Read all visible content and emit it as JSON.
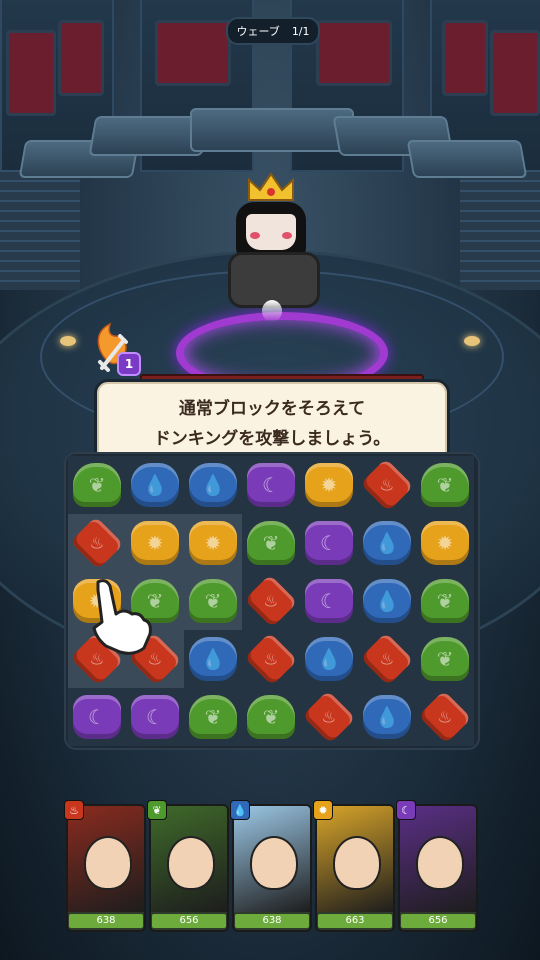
{
  "wave": {
    "label": "ウェーブ",
    "value": "1/1"
  },
  "boss": {
    "name_icon": "don-king-boss"
  },
  "attack": {
    "icon": "sword-slash-icon",
    "badge": "1"
  },
  "tooltip": {
    "line1": "通常ブロックをそろえて",
    "line2": "ドンキングを攻撃しましょう。"
  },
  "board": {
    "highlighted_cells": [
      [
        1,
        0
      ],
      [
        1,
        1
      ],
      [
        1,
        2
      ],
      [
        2,
        0
      ],
      [
        2,
        1
      ],
      [
        2,
        2
      ],
      [
        3,
        0
      ],
      [
        3,
        1
      ]
    ],
    "rows": [
      [
        "leaf",
        "water",
        "water",
        "moon",
        "sun",
        "fire",
        "leaf"
      ],
      [
        "fire",
        "sun",
        "sun",
        "leaf",
        "moon",
        "water",
        "sun"
      ],
      [
        "sun",
        "leaf",
        "leaf",
        "fire",
        "moon",
        "water",
        "leaf"
      ],
      [
        "fire",
        "fire",
        "water",
        "fire",
        "water",
        "fire",
        "leaf"
      ],
      [
        "moon",
        "moon",
        "leaf",
        "leaf",
        "fire",
        "water",
        "fire"
      ]
    ]
  },
  "gem_symbols": {
    "leaf": "❦",
    "water": "💧",
    "moon": "☾",
    "sun": "✹",
    "fire": "♨"
  },
  "gem_colors": {
    "leaf": "#4f9a2d",
    "water": "#2f69b8",
    "moon": "#7a3bb8",
    "sun": "#e7a21c",
    "fire": "#c8371d"
  },
  "tutorial_hand": {
    "icon": "pointing-hand-icon"
  },
  "team": [
    {
      "element": "fire",
      "hp": "638",
      "hp_ratio": 1.0,
      "bg": "#8a2b1e",
      "icon": "curly-hair-hero-portrait"
    },
    {
      "element": "leaf",
      "hp": "656",
      "hp_ratio": 1.0,
      "bg": "#3f6a2a",
      "icon": "glasses-hat-hero-portrait"
    },
    {
      "element": "water",
      "hp": "638",
      "hp_ratio": 1.0,
      "bg": "#9cc8e6",
      "icon": "blue-hair-girl-portrait"
    },
    {
      "element": "sun",
      "hp": "663",
      "hp_ratio": 1.0,
      "bg": "#d9a52a",
      "icon": "bee-hero-portrait"
    },
    {
      "element": "moon",
      "hp": "656",
      "hp_ratio": 1.0,
      "bg": "#5b2f86",
      "icon": "top-hat-hero-portrait"
    }
  ]
}
